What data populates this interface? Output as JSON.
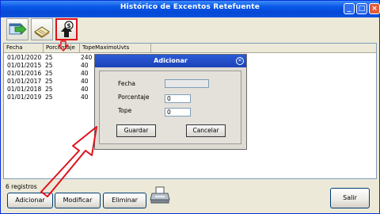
{
  "window": {
    "title": "Histórico de Excentos Retefuente",
    "controls": {
      "minimize": "_",
      "maximize": "□",
      "close": "×"
    }
  },
  "toolbar": {
    "items": [
      {
        "name": "export-icon"
      },
      {
        "name": "book-icon"
      },
      {
        "name": "upload-money-icon",
        "highlight_color": "#e0101a"
      }
    ]
  },
  "table": {
    "columns": [
      "Fecha",
      "Porcentaje",
      "TopeMaximoUvts"
    ],
    "rows": [
      [
        "01/01/2020",
        "25",
        "240"
      ],
      [
        "01/01/2015",
        "25",
        "40"
      ],
      [
        "01/01/2016",
        "25",
        "40"
      ],
      [
        "01/01/2017",
        "25",
        "40"
      ],
      [
        "01/01/2018",
        "25",
        "40"
      ],
      [
        "01/01/2019",
        "25",
        "40"
      ]
    ]
  },
  "footer": {
    "count": "6 registros",
    "add_label": "Adicionar",
    "modify_label": "Modificar",
    "delete_label": "Eliminar",
    "exit_label": "Salir"
  },
  "dialog": {
    "title": "Adicionar",
    "fields": {
      "fecha_label": "Fecha",
      "fecha_value": "",
      "porcentaje_label": "Porcentaje",
      "porcentaje_value": "0",
      "tope_label": "Tope",
      "tope_value": "0"
    },
    "save_label": "Guardar",
    "cancel_label": "Cancelar"
  },
  "annotation": {
    "arrow_color": "#e0101a"
  }
}
